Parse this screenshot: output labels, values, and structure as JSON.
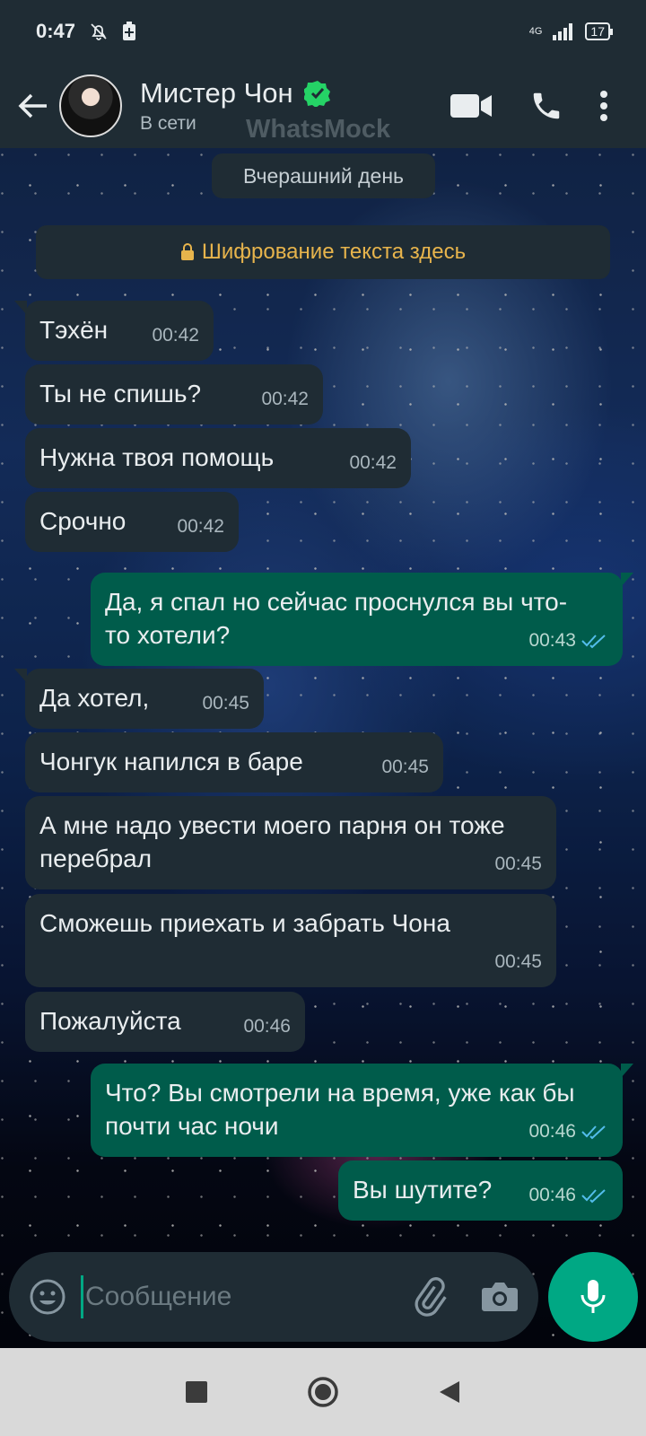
{
  "status_bar": {
    "time": "0:47",
    "network": "4G",
    "battery": "17"
  },
  "header": {
    "contact_name": "Мистер Чон",
    "contact_status": "В сети",
    "watermark": "WhatsMock"
  },
  "chat": {
    "date_label": "Вчерашний день",
    "encryption_notice": "Шифрование текста здесь",
    "messages": [
      {
        "direction": "in",
        "text": "Тэхён",
        "time": "00:42"
      },
      {
        "direction": "in",
        "text": "Ты не спишь?",
        "time": "00:42"
      },
      {
        "direction": "in",
        "text": "Нужна твоя помощь",
        "time": "00:42"
      },
      {
        "direction": "in",
        "text": "Срочно",
        "time": "00:42"
      },
      {
        "direction": "out",
        "text": "Да, я спал но сейчас проснулся вы что-то хотели?",
        "time": "00:43",
        "read": true
      },
      {
        "direction": "in",
        "text": "Да хотел,",
        "time": "00:45"
      },
      {
        "direction": "in",
        "text": "Чонгук напился в баре",
        "time": "00:45"
      },
      {
        "direction": "in",
        "text": "А мне надо увести моего парня он тоже перебрал",
        "time": "00:45"
      },
      {
        "direction": "in",
        "text": "Сможешь приехать и забрать Чона",
        "time": "00:45"
      },
      {
        "direction": "in",
        "text": "Пожалуйста",
        "time": "00:46"
      },
      {
        "direction": "out",
        "text": "Что? Вы смотрели на время, уже как бы почти час ночи",
        "time": "00:46",
        "read": true
      },
      {
        "direction": "out",
        "text": "Вы шутите?",
        "time": "00:46",
        "read": true
      }
    ]
  },
  "input": {
    "placeholder": "Сообщение"
  },
  "colors": {
    "accent": "#00a884",
    "incoming_bubble": "#1f2c34",
    "outgoing_bubble": "#005c4b",
    "encryption_text": "#e7b44c",
    "read_ticks": "#53bdeb"
  },
  "icons": [
    "arrow-left-icon",
    "verified-badge-icon",
    "video-call-icon",
    "phone-icon",
    "more-vert-icon",
    "lock-icon",
    "emoji-icon",
    "attach-icon",
    "camera-icon",
    "mic-icon",
    "double-check-icon",
    "nav-recents-icon",
    "nav-home-icon",
    "nav-back-icon"
  ]
}
